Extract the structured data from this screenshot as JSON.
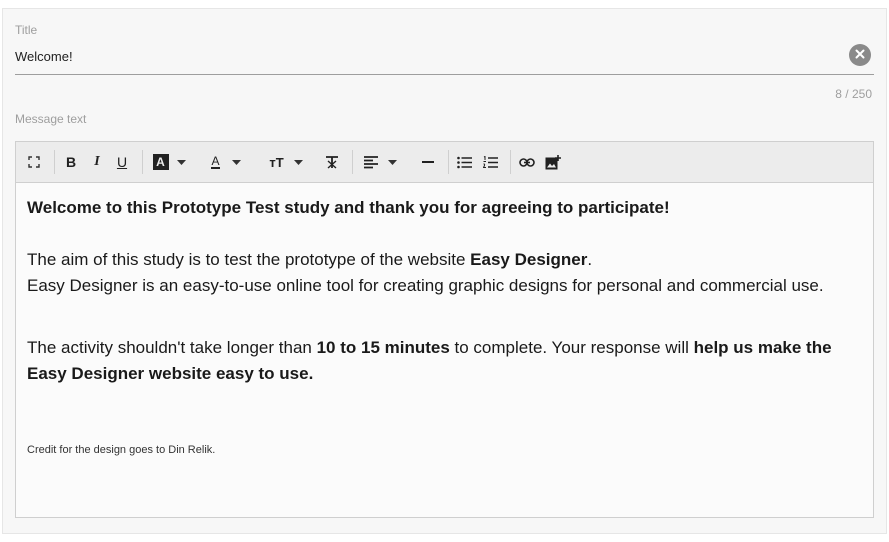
{
  "title_field": {
    "label": "Title",
    "value": "Welcome!",
    "counter": "8 / 250"
  },
  "message_field": {
    "label": "Message text"
  },
  "toolbar": {
    "icons": [
      "fullscreen-icon",
      "bold-icon",
      "italic-icon",
      "underline-icon",
      "highlight-color-icon",
      "text-color-icon",
      "font-size-icon",
      "clear-format-icon",
      "align-left-icon",
      "horizontal-line-icon",
      "bullet-list-icon",
      "numbered-list-icon",
      "link-icon",
      "insert-image-icon"
    ],
    "bold_letter": "B",
    "italic_letter": "I",
    "underline_letter": "U",
    "highlight_letter": "A",
    "text_color_letter": "A",
    "font_size_letter": "тT",
    "clear_format_letter": "T"
  },
  "content": {
    "heading": "Welcome to this Prototype Test study and thank you for agreeing to participate!",
    "p1_a": "The aim of this study is to test the prototype of the website ",
    "p1_b": "Easy Designer",
    "p1_c": ".",
    "p2": "Easy Designer is an easy-to-use online tool for creating graphic designs for personal and commercial use.",
    "p3_a": "The activity shouldn't take longer than ",
    "p3_b": "10 to 15 minutes",
    "p3_c": " to complete. Your response will ",
    "p3_d": "help us make the Easy Designer website easy to use.",
    "credit": "Credit for the design goes to Din Relik."
  },
  "colors": {
    "panel_bg": "#f7f7f7",
    "toolbar_bg": "#ececec",
    "label_gray": "#9e9e9e",
    "clear_button": "#8a8a8a"
  }
}
